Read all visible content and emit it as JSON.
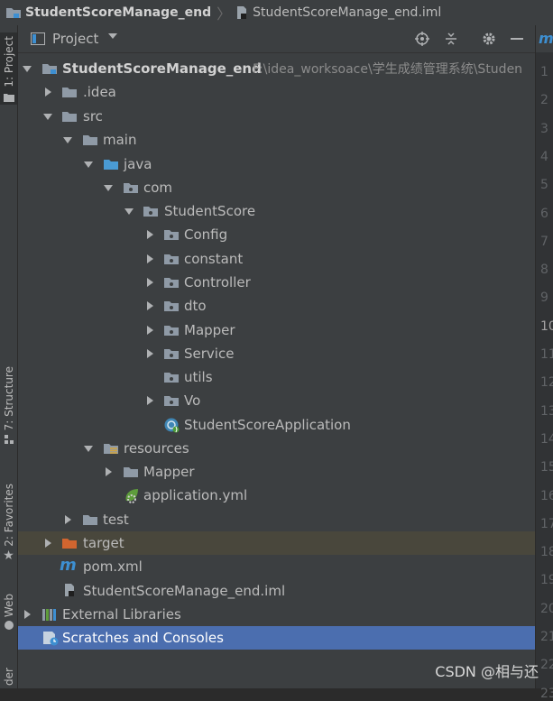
{
  "breadcrumb": {
    "project": "StudentScoreManage_end",
    "file": "StudentScoreManage_end.iml"
  },
  "tool_strip": {
    "project_tab": "1: Project",
    "structure_tab": "7: Structure",
    "favorites_tab": "2: Favorites",
    "web_tab": "Web",
    "bottom_tab": "der"
  },
  "panel": {
    "title": "Project",
    "icons": [
      "locate-icon",
      "collapse-all-icon",
      "settings-icon",
      "minimize-icon"
    ]
  },
  "tree": {
    "root_name": "StudentScoreManage_end",
    "root_path": "F:\\idea_worksoace\\学生成绩管理系统\\Studen",
    "idea": ".idea",
    "src": "src",
    "main": "main",
    "java": "java",
    "com": "com",
    "studentscore": "StudentScore",
    "config": "Config",
    "constant": "constant",
    "controller": "Controller",
    "dto": "dto",
    "mapper": "Mapper",
    "service": "Service",
    "utils": "utils",
    "vo": "Vo",
    "app": "StudentScoreApplication",
    "resources": "resources",
    "res_mapper": "Mapper",
    "app_yml": "application.yml",
    "test": "test",
    "target": "target",
    "pom": "pom.xml",
    "iml": "StudentScoreManage_end.iml",
    "ext_libs": "External Libraries",
    "scratches": "Scratches and Consoles"
  },
  "editor": {
    "line_numbers": [
      "1",
      "2",
      "3",
      "4",
      "5",
      "6",
      "7",
      "8",
      "9",
      "10",
      "11",
      "12",
      "13",
      "14",
      "15",
      "16",
      "17",
      "18",
      "19",
      "20",
      "21",
      "22",
      "23"
    ]
  },
  "watermark": "CSDN @相与还"
}
